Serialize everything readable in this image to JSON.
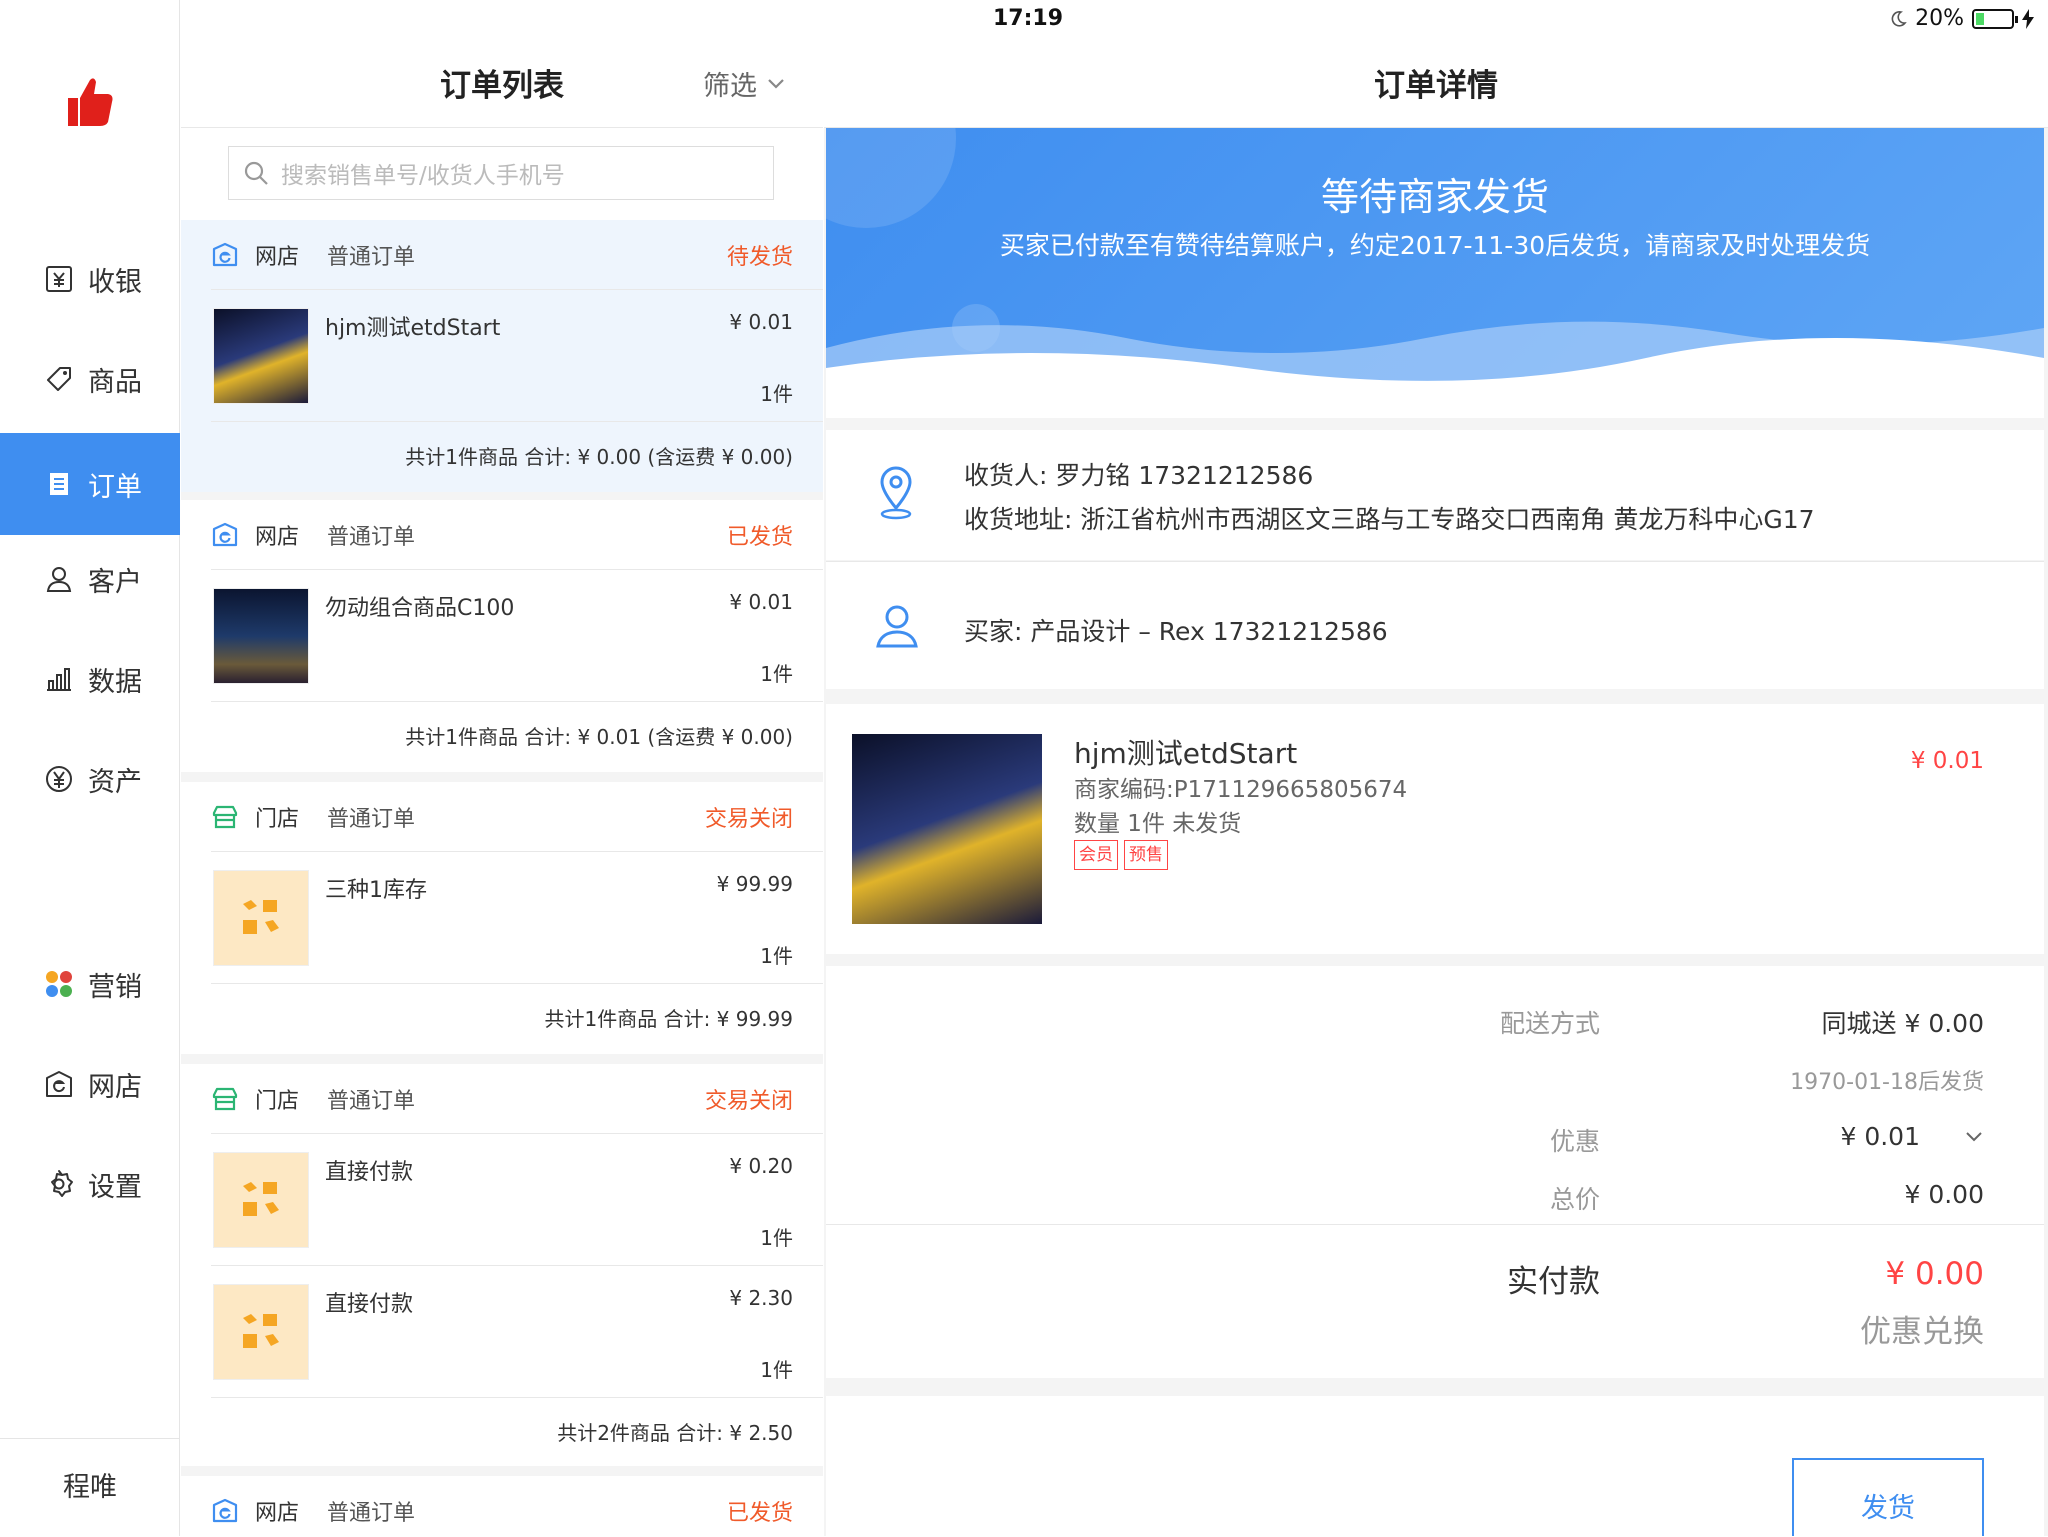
{
  "status_bar": {
    "device": "iPad",
    "time": "17:19",
    "battery": "20%"
  },
  "sidebar": {
    "items": [
      {
        "label": "收银",
        "icon": "cashier-icon"
      },
      {
        "label": "商品",
        "icon": "tag-icon"
      },
      {
        "label": "订单",
        "icon": "order-icon"
      },
      {
        "label": "客户",
        "icon": "customer-icon"
      },
      {
        "label": "数据",
        "icon": "chart-icon"
      },
      {
        "label": "资产",
        "icon": "yuan-icon"
      },
      {
        "label": "营销",
        "icon": "marketing-icon"
      },
      {
        "label": "网店",
        "icon": "webstore-icon"
      },
      {
        "label": "设置",
        "icon": "gear-icon"
      }
    ],
    "active": "订单",
    "user": "程唯"
  },
  "order_list": {
    "title": "订单列表",
    "filter": "筛选",
    "search_placeholder": "搜索销售单号/收货人手机号",
    "orders": [
      {
        "channel": "网店",
        "type": "普通订单",
        "status": "待发货",
        "items": [
          {
            "name": "hjm测试etdStart",
            "price": "¥ 0.01",
            "qty": "1件"
          }
        ],
        "summary": "共计1件商品  合计: ¥ 0.00 (含运费 ¥ 0.00)"
      },
      {
        "channel": "网店",
        "type": "普通订单",
        "status": "已发货",
        "items": [
          {
            "name": "勿动组合商品C100",
            "price": "¥ 0.01",
            "qty": "1件"
          }
        ],
        "summary": "共计1件商品  合计: ¥ 0.01 (含运费 ¥ 0.00)"
      },
      {
        "channel": "门店",
        "type": "普通订单",
        "status": "交易关闭",
        "items": [
          {
            "name": "三种1库存",
            "price": "¥ 99.99",
            "qty": "1件"
          }
        ],
        "summary": "共计1件商品  合计: ¥ 99.99"
      },
      {
        "channel": "门店",
        "type": "普通订单",
        "status": "交易关闭",
        "items": [
          {
            "name": "直接付款",
            "price": "¥ 0.20",
            "qty": "1件"
          },
          {
            "name": "直接付款",
            "price": "¥ 2.30",
            "qty": "1件"
          }
        ],
        "summary": "共计2件商品  合计: ¥ 2.50"
      },
      {
        "channel": "网店",
        "type": "普通订单",
        "status": "已发货",
        "items": [],
        "summary": ""
      }
    ]
  },
  "detail": {
    "title": "订单详情",
    "banner_title": "等待商家发货",
    "banner_sub": "买家已付款至有赞待结算账户，约定2017-11-30后发货，请商家及时处理发货",
    "receiver": "收货人: 罗力铭  17321212586",
    "address": "收货地址: 浙江省杭州市西湖区文三路与工专路交口西南角 黄龙万科中心G17",
    "buyer": "买家: 产品设计 – Rex 17321212586",
    "goods": {
      "name": "hjm测试etdStart",
      "code": "商家编码:P171129665805674",
      "qty_status": "数量 1件    未发货",
      "tags": [
        "会员",
        "预售"
      ],
      "price": "¥ 0.01"
    },
    "summary": {
      "delivery_label": "配送方式",
      "delivery_value": "同城送  ¥ 0.00",
      "ship_note": "1970-01-18后发货",
      "discount_label": "优惠",
      "discount_value": "¥ 0.01",
      "total_label": "总价",
      "total_value": "¥ 0.00",
      "paid_label": "实付款",
      "paid_value": "¥ 0.00",
      "redeem": "优惠兑换"
    },
    "ship_button": "发货"
  },
  "colors": {
    "accent": "#3f8ef0",
    "status_orange": "#f05a2a",
    "price_red": "#f44444"
  }
}
